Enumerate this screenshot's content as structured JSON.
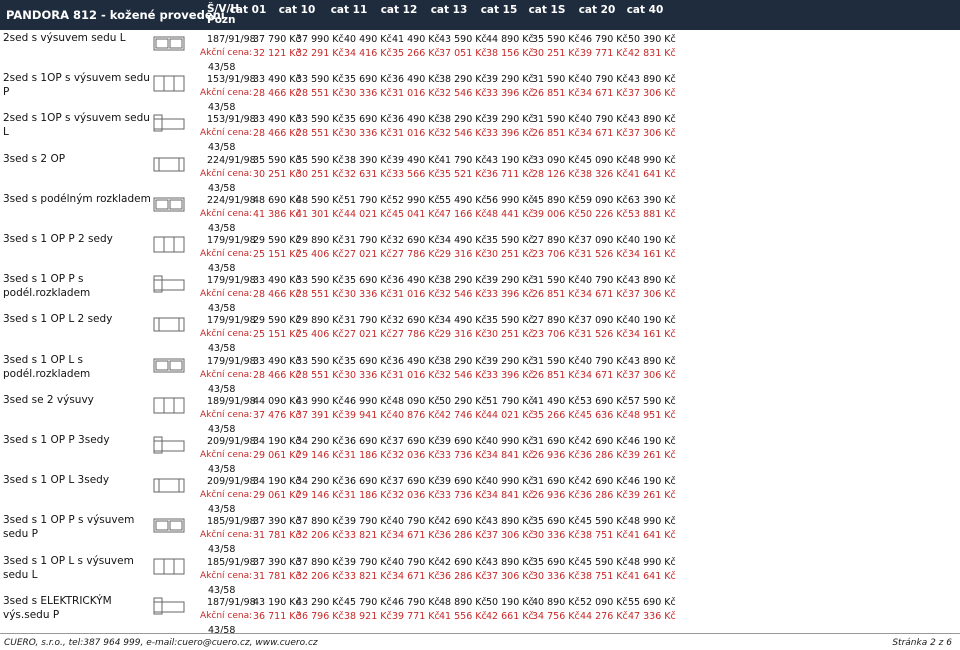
{
  "header": {
    "title": "PANDORA 812 - kožené provedení",
    "sv_label_1": "Š/V/H",
    "sv_label_2": "Pozn",
    "cats": [
      "cat 01",
      "cat 10",
      "cat 11",
      "cat 12",
      "cat 13",
      "cat 15",
      "cat 1S",
      "cat 20",
      "cat 40"
    ]
  },
  "akce_label": "Akční cena:",
  "rows": [
    {
      "name": "2sed s výsuvem sedu L",
      "code": "187/91/98",
      "code2": "43/58",
      "prices": [
        "37 790 Kč",
        "37 990 Kč",
        "40 490 Kč",
        "41 490 Kč",
        "43 590 Kč",
        "44 890 Kč",
        "35 590 Kč",
        "46 790 Kč",
        "50 390 Kč"
      ],
      "akce": [
        "32 121 Kč",
        "32 291 Kč",
        "34 416 Kč",
        "35 266 Kč",
        "37 051 Kč",
        "38 156 Kč",
        "30 251 Kč",
        "39 771 Kč",
        "42 831 Kč"
      ]
    },
    {
      "name": "2sed s 1OP s výsuvem sedu P",
      "code": "153/91/98",
      "code2": "43/58",
      "prices": [
        "33 490 Kč",
        "33 590 Kč",
        "35 690 Kč",
        "36 490 Kč",
        "38 290 Kč",
        "39 290 Kč",
        "31 590 Kč",
        "40 790 Kč",
        "43 890 Kč"
      ],
      "akce": [
        "28 466 Kč",
        "28 551 Kč",
        "30 336 Kč",
        "31 016 Kč",
        "32 546 Kč",
        "33 396 Kč",
        "26 851 Kč",
        "34 671 Kč",
        "37 306 Kč"
      ]
    },
    {
      "name": "2sed s 1OP s výsuvem sedu L",
      "code": "153/91/98",
      "code2": "43/58",
      "prices": [
        "33 490 Kč",
        "33 590 Kč",
        "35 690 Kč",
        "36 490 Kč",
        "38 290 Kč",
        "39 290 Kč",
        "31 590 Kč",
        "40 790 Kč",
        "43 890 Kč"
      ],
      "akce": [
        "28 466 Kč",
        "28 551 Kč",
        "30 336 Kč",
        "31 016 Kč",
        "32 546 Kč",
        "33 396 Kč",
        "26 851 Kč",
        "34 671 Kč",
        "37 306 Kč"
      ]
    },
    {
      "name": "3sed s 2 OP",
      "code": "224/91/98",
      "code2": "43/58",
      "prices": [
        "35 590 Kč",
        "35 590 Kč",
        "38 390 Kč",
        "39 490 Kč",
        "41 790 Kč",
        "43 190 Kč",
        "33 090 Kč",
        "45 090 Kč",
        "48 990 Kč"
      ],
      "akce": [
        "30 251 Kč",
        "30 251 Kč",
        "32 631 Kč",
        "33 566 Kč",
        "35 521 Kč",
        "36 711 Kč",
        "28 126 Kč",
        "38 326 Kč",
        "41 641 Kč"
      ]
    },
    {
      "name": "3sed s podélným rozkladem",
      "code": "224/91/98",
      "code2": "43/58",
      "prices": [
        "48 690 Kč",
        "48 590 Kč",
        "51 790 Kč",
        "52 990 Kč",
        "55 490 Kč",
        "56 990 Kč",
        "45 890 Kč",
        "59 090 Kč",
        "63 390 Kč"
      ],
      "akce": [
        "41 386 Kč",
        "41 301 Kč",
        "44 021 Kč",
        "45 041 Kč",
        "47 166 Kč",
        "48 441 Kč",
        "39 006 Kč",
        "50 226 Kč",
        "53 881 Kč"
      ]
    },
    {
      "name": "3sed s 1 OP P 2 sedy",
      "code": "179/91/98",
      "code2": "43/58",
      "prices": [
        "29 590 Kč",
        "29 890 Kč",
        "31 790 Kč",
        "32 690 Kč",
        "34 490 Kč",
        "35 590 Kč",
        "27 890 Kč",
        "37 090 Kč",
        "40 190 Kč"
      ],
      "akce": [
        "25 151 Kč",
        "25 406 Kč",
        "27 021 Kč",
        "27 786 Kč",
        "29 316 Kč",
        "30 251 Kč",
        "23 706 Kč",
        "31 526 Kč",
        "34 161 Kč"
      ]
    },
    {
      "name": "3sed s 1 OP P s podél.rozkladem",
      "code": "179/91/98",
      "code2": "43/58",
      "prices": [
        "33 490 Kč",
        "33 590 Kč",
        "35 690 Kč",
        "36 490 Kč",
        "38 290 Kč",
        "39 290 Kč",
        "31 590 Kč",
        "40 790 Kč",
        "43 890 Kč"
      ],
      "akce": [
        "28 466 Kč",
        "28 551 Kč",
        "30 336 Kč",
        "31 016 Kč",
        "32 546 Kč",
        "33 396 Kč",
        "26 851 Kč",
        "34 671 Kč",
        "37 306 Kč"
      ]
    },
    {
      "name": "3sed s 1 OP L 2 sedy",
      "code": "179/91/98",
      "code2": "43/58",
      "prices": [
        "29 590 Kč",
        "29 890 Kč",
        "31 790 Kč",
        "32 690 Kč",
        "34 490 Kč",
        "35 590 Kč",
        "27 890 Kč",
        "37 090 Kč",
        "40 190 Kč"
      ],
      "akce": [
        "25 151 Kč",
        "25 406 Kč",
        "27 021 Kč",
        "27 786 Kč",
        "29 316 Kč",
        "30 251 Kč",
        "23 706 Kč",
        "31 526 Kč",
        "34 161 Kč"
      ]
    },
    {
      "name": "3sed s 1 OP L s podél.rozkladem",
      "code": "179/91/98",
      "code2": "43/58",
      "prices": [
        "33 490 Kč",
        "33 590 Kč",
        "35 690 Kč",
        "36 490 Kč",
        "38 290 Kč",
        "39 290 Kč",
        "31 590 Kč",
        "40 790 Kč",
        "43 890 Kč"
      ],
      "akce": [
        "28 466 Kč",
        "28 551 Kč",
        "30 336 Kč",
        "31 016 Kč",
        "32 546 Kč",
        "33 396 Kč",
        "26 851 Kč",
        "34 671 Kč",
        "37 306 Kč"
      ]
    },
    {
      "name": "3sed se 2 výsuvy",
      "code": "189/91/98",
      "code2": "43/58",
      "prices": [
        "44 090 Kč",
        "43 990 Kč",
        "46 990 Kč",
        "48 090 Kč",
        "50 290 Kč",
        "51 790 Kč",
        "41 490 Kč",
        "53 690 Kč",
        "57 590 Kč"
      ],
      "akce": [
        "37 476 Kč",
        "37 391 Kč",
        "39 941 Kč",
        "40 876 Kč",
        "42 746 Kč",
        "44 021 Kč",
        "35 266 Kč",
        "45 636 Kč",
        "48 951 Kč"
      ]
    },
    {
      "name": "3sed s 1 OP P 3sedy",
      "code": "209/91/98",
      "code2": "43/58",
      "prices": [
        "34 190 Kč",
        "34 290 Kč",
        "36 690 Kč",
        "37 690 Kč",
        "39 690 Kč",
        "40 990 Kč",
        "31 690 Kč",
        "42 690 Kč",
        "46 190 Kč"
      ],
      "akce": [
        "29 061 Kč",
        "29 146 Kč",
        "31 186 Kč",
        "32 036 Kč",
        "33 736 Kč",
        "34 841 Kč",
        "26 936 Kč",
        "36 286 Kč",
        "39 261 Kč"
      ]
    },
    {
      "name": "3sed s 1 OP L 3sedy",
      "code": "209/91/98",
      "code2": "43/58",
      "prices": [
        "34 190 Kč",
        "34 290 Kč",
        "36 690 Kč",
        "37 690 Kč",
        "39 690 Kč",
        "40 990 Kč",
        "31 690 Kč",
        "42 690 Kč",
        "46 190 Kč"
      ],
      "akce": [
        "29 061 Kč",
        "29 146 Kč",
        "31 186 Kč",
        "32 036 Kč",
        "33 736 Kč",
        "34 841 Kč",
        "26 936 Kč",
        "36 286 Kč",
        "39 261 Kč"
      ]
    },
    {
      "name": "3sed s 1 OP P s výsuvem sedu P",
      "code": "185/91/98",
      "code2": "43/58",
      "prices": [
        "37 390 Kč",
        "37 890 Kč",
        "39 790 Kč",
        "40 790 Kč",
        "42 690 Kč",
        "43 890 Kč",
        "35 690 Kč",
        "45 590 Kč",
        "48 990 Kč"
      ],
      "akce": [
        "31 781 Kč",
        "32 206 Kč",
        "33 821 Kč",
        "34 671 Kč",
        "36 286 Kč",
        "37 306 Kč",
        "30 336 Kč",
        "38 751 Kč",
        "41 641 Kč"
      ]
    },
    {
      "name": "3sed s 1 OP L s výsuvem sedu L",
      "code": "185/91/98",
      "code2": "43/58",
      "prices": [
        "37 390 Kč",
        "37 890 Kč",
        "39 790 Kč",
        "40 790 Kč",
        "42 690 Kč",
        "43 890 Kč",
        "35 690 Kč",
        "45 590 Kč",
        "48 990 Kč"
      ],
      "akce": [
        "31 781 Kč",
        "32 206 Kč",
        "33 821 Kč",
        "34 671 Kč",
        "36 286 Kč",
        "37 306 Kč",
        "30 336 Kč",
        "38 751 Kč",
        "41 641 Kč"
      ]
    },
    {
      "name": "3sed s ELEKTRICKÝM výs.sedu P",
      "code": "187/91/98",
      "code2": "43/58",
      "prices": [
        "43 190 Kč",
        "43 290 Kč",
        "45 790 Kč",
        "46 790 Kč",
        "48 890 Kč",
        "50 190 Kč",
        "40 890 Kč",
        "52 090 Kč",
        "55 690 Kč"
      ],
      "akce": [
        "36 711 Kč",
        "36 796 Kč",
        "38 921 Kč",
        "39 771 Kč",
        "41 556 Kč",
        "42 661 Kč",
        "34 756 Kč",
        "44 276 Kč",
        "47 336 Kč"
      ]
    }
  ],
  "footer": {
    "left": "CUERO, s.r.o., tel:387 964 999, e-mail:cuero@cuero.cz, www.cuero.cz",
    "right": "Stránka 2 z 6"
  }
}
